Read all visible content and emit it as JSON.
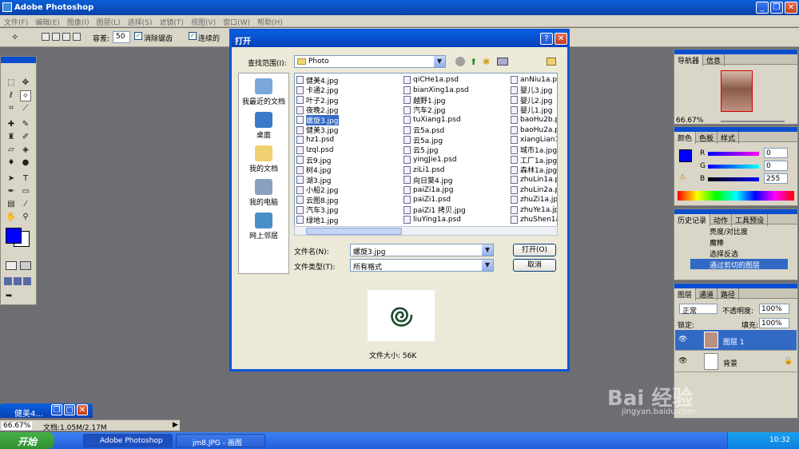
{
  "app": {
    "title": "Adobe Photoshop"
  },
  "menu": [
    "文件(F)",
    "编辑(E)",
    "图像(I)",
    "图层(L)",
    "选择(S)",
    "滤镜(T)",
    "视图(V)",
    "窗口(W)",
    "帮助(H)"
  ],
  "options": {
    "tolerance_label": "容差:",
    "tolerance_value": "50",
    "antialias": "消除锯齿",
    "contiguous": "连续的"
  },
  "dialog": {
    "title": "打开",
    "lookin_label": "查找范围(I):",
    "lookin_value": "Photo",
    "places": [
      "我最近的文档",
      "桌面",
      "我的文档",
      "我的电脑",
      "网上邻居"
    ],
    "files_col1": [
      "健美4.jpg",
      "卡通2.jpg",
      "叶子2.jpg",
      "夜晚2.jpg",
      "螺旋3.jpg",
      "健美3.jpg",
      "hz1.psd",
      "lzql.psd",
      "云9.jpg",
      "树4.jpg",
      "湖3.jpg",
      "小船2.jpg",
      "云图8.jpg",
      "汽车3.jpg",
      "绿地1.jpg"
    ],
    "files_col2": [
      "qiCHe1a.psd",
      "bianXing1a.psd",
      "越野1.jpg",
      "汽车2.jpg",
      "tuXiang1.psd",
      "云5a.psd",
      "云5a.jpg",
      "云5.jpg",
      "yingJie1.psd",
      "ziLi1.psd",
      "向日葵4.jpg",
      "paiZi1a.jpg",
      "paiZi1.psd",
      "paiZi1 拷贝.jpg",
      "liuYing1a.psd"
    ],
    "files_col3": [
      "anNiu1a.ps",
      "婴儿3.jpg",
      "婴儿2.jpg",
      "婴儿1.jpg",
      "baoHu2b.ps",
      "baoHu2a.ps",
      "xiangLian1",
      "城市1a.jpg",
      "工厂1a.jpg",
      "森林1a.jpg",
      "zhuLin1a.p",
      "zhuLin2a.p",
      "zhuZi1a.jpg",
      "zhuYe1a.jpg",
      "zhuShen1a."
    ],
    "selected_file": "螺旋3.jpg",
    "filename_label": "文件名(N):",
    "filename_value": "螺旋3.jpg",
    "filetype_label": "文件类型(T):",
    "filetype_value": "所有格式",
    "open_button": "打开(O)",
    "cancel_button": "取消",
    "filesize": "文件大小: 56K"
  },
  "navigator": {
    "tabs": [
      "导航器",
      "信息"
    ],
    "zoom": "66.67%"
  },
  "color_panel": {
    "tabs": [
      "颜色",
      "色板",
      "样式"
    ],
    "r_label": "R",
    "g_label": "G",
    "b_label": "B",
    "r": "0",
    "g": "0",
    "b": "255"
  },
  "history": {
    "tabs": [
      "历史记录",
      "动作",
      "工具预设"
    ],
    "items": [
      "亮度/对比度",
      "魔棒",
      "选择反选",
      "通过剪切的图层"
    ]
  },
  "layers": {
    "tabs": [
      "图层",
      "通道",
      "路径"
    ],
    "blend": "正常",
    "opacity_label": "不透明度:",
    "opacity": "100%",
    "lock_label": "锁定:",
    "fill_label": "填充:",
    "fill": "100%",
    "rows": [
      "图层 1",
      "背景"
    ]
  },
  "doc_tab": {
    "title": "健美4..."
  },
  "status": {
    "zoom": "66.67%",
    "doc": "文档:1.05M/2.17M"
  },
  "taskbar": {
    "start": "开始",
    "tasks": [
      "Adobe Photoshop",
      "jm8.JPG - 画图"
    ],
    "time": "10:32"
  },
  "watermark": {
    "brand": "Bai 经验",
    "url": "jingyan.baidu.com"
  },
  "colors": {
    "titlebar": "#0a5fd8",
    "selection": "#316ac5",
    "foreground": "#0000ff",
    "workspace": "#6e6e72"
  }
}
